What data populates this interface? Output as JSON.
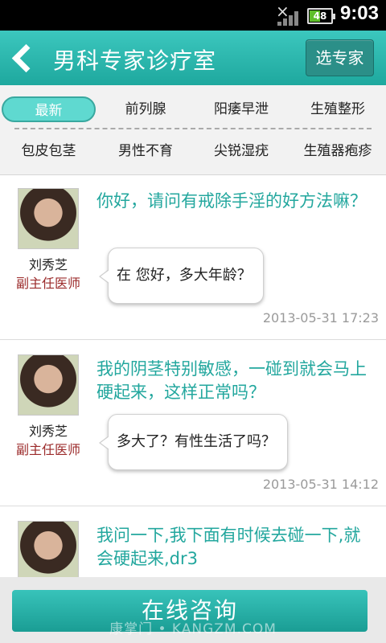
{
  "status_bar": {
    "warning_icon": "×",
    "battery_text": "48",
    "battery_level_percent": 48,
    "time": "9:03"
  },
  "header": {
    "back_icon": "back-chevron-icon",
    "title": "男科专家诊疗室",
    "select_expert": "选专家"
  },
  "tabs": [
    "最新",
    "前列腺",
    "阳痿早泄",
    "生殖整形",
    "包皮包茎",
    "男性不育",
    "尖锐湿疣",
    "生殖器疱疹"
  ],
  "items": [
    {
      "doctor_name": "刘秀芝",
      "doctor_title": "副主任医师",
      "question": "你好，请问有戒除手淫的好方法嘛？",
      "answer": "在 您好，多大年龄？",
      "time": "2013-05-31 17:23"
    },
    {
      "doctor_name": "刘秀芝",
      "doctor_title": "副主任医师",
      "question": "我的阴茎特别敏感，一碰到就会马上硬起来，这样正常吗？",
      "answer": "多大了？有性生活了吗？",
      "time": "2013-05-31 14:12"
    },
    {
      "question": "我问一下,我下面有时候去碰一下,就会硬起来,dr3"
    }
  ],
  "footer": {
    "consult_button": "在线咨询",
    "watermark": "康掌门 • KANGZM.COM"
  }
}
